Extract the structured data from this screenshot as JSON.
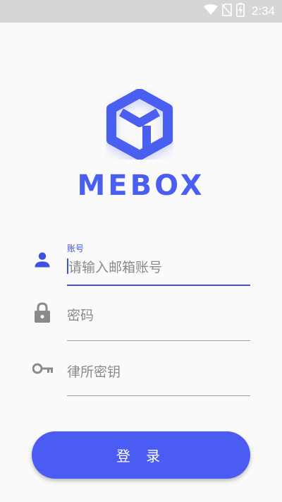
{
  "status_bar": {
    "time": "2:34",
    "icons": [
      "wifi-icon",
      "no-sim-icon",
      "battery-charging-icon"
    ]
  },
  "brand": {
    "logo_icon": "cube-logo-icon",
    "name": "MEBOX",
    "color": "#4a5ef0"
  },
  "form": {
    "account": {
      "icon": "person-icon",
      "label": "账号",
      "placeholder": "请输入邮箱账号"
    },
    "password": {
      "icon": "lock-icon",
      "placeholder": "密码"
    },
    "firm_key": {
      "icon": "key-icon",
      "placeholder": "律所密钥"
    }
  },
  "login_button": {
    "label": "登 录",
    "color": "#4a5cf2"
  }
}
